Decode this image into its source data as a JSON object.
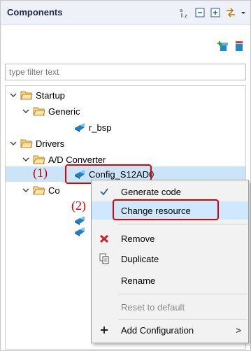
{
  "panel": {
    "title": "Components",
    "filter_placeholder": "type filter text"
  },
  "toolbar": {
    "icons": [
      "sort-alpha-icon",
      "collapse-all-icon",
      "expand-all-icon",
      "link-icon",
      "view-menu-chevron-icon"
    ],
    "add_icon": "add-component-icon",
    "remove_icon": "remove-component-icon"
  },
  "tree": {
    "startup": "Startup",
    "generic": "Generic",
    "r_bsp": "r_bsp",
    "drivers": "Drivers",
    "ad_converter": "A/D Converter",
    "config_s12ad0": "Config_S12AD0",
    "co_partial": "Co"
  },
  "annotations": {
    "one": "(1)",
    "two": "(2)",
    "color": "#e00000"
  },
  "context_menu": {
    "generate_code": "Generate code",
    "change_resource": "Change resource",
    "remove": "Remove",
    "duplicate": "Duplicate",
    "rename": "Rename",
    "reset_to_default": "Reset to default",
    "add_configuration": "Add Configuration",
    "submenu_arrow": ">"
  },
  "colors": {
    "selection": "#cce4f7",
    "menu_highlight": "#cde8ff",
    "folder": "#e8a33a"
  }
}
